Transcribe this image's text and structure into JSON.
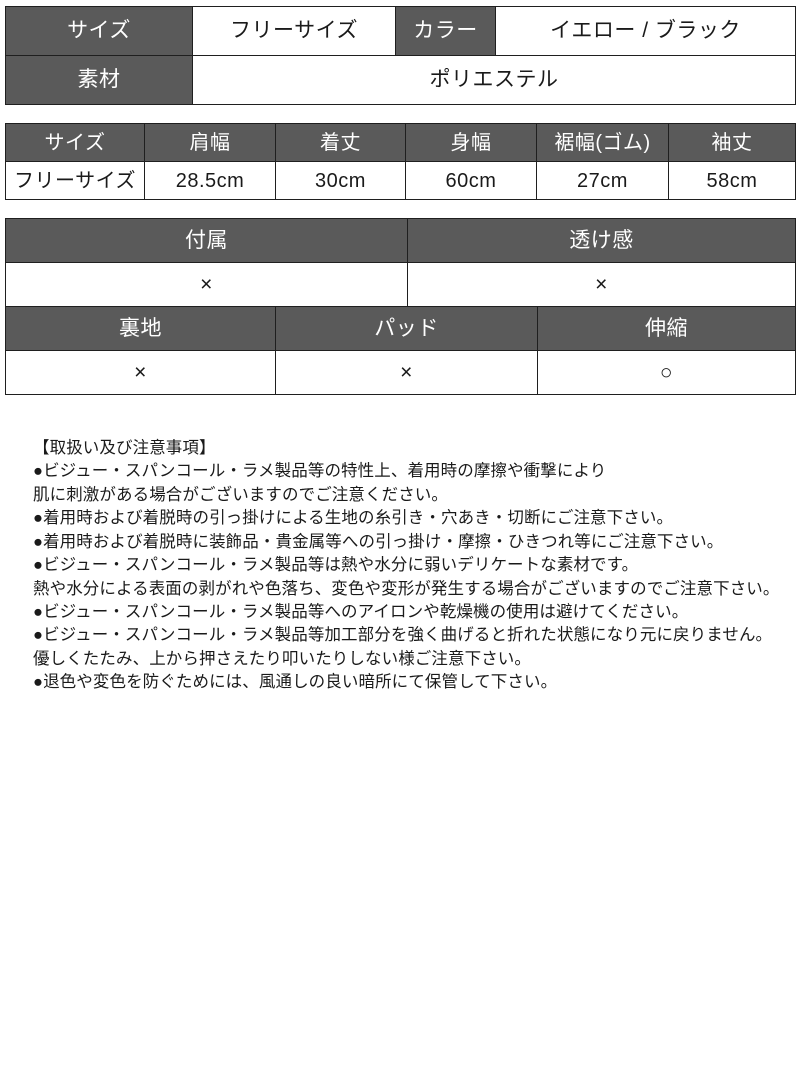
{
  "tables": {
    "basic": {
      "rows": [
        {
          "cells": [
            {
              "text": "サイズ",
              "type": "header",
              "name": "label-size"
            },
            {
              "text": "フリーサイズ",
              "type": "value",
              "name": "value-size"
            },
            {
              "text": "カラー",
              "type": "header",
              "name": "label-color"
            },
            {
              "text": "イエロー / ブラック",
              "type": "value",
              "name": "value-color"
            }
          ]
        },
        {
          "cells": [
            {
              "text": "素材",
              "type": "header",
              "name": "label-material"
            },
            {
              "text": "ポリエステル",
              "type": "value",
              "name": "value-material"
            }
          ]
        }
      ]
    },
    "measurements": {
      "headers": [
        "サイズ",
        "肩幅",
        "着丈",
        "身幅",
        "裾幅(ゴム)",
        "袖丈"
      ],
      "values": [
        "フリーサイズ",
        "28.5cm",
        "30cm",
        "60cm",
        "27cm",
        "58cm"
      ]
    },
    "features": {
      "group1": {
        "headers": [
          "付属",
          "透け感"
        ],
        "values": [
          "×",
          "×"
        ]
      },
      "group2": {
        "headers": [
          "裏地",
          "パッド",
          "伸縮"
        ],
        "values": [
          "×",
          "×",
          "○"
        ]
      }
    }
  },
  "notes": {
    "title": "【取扱い及び注意事項】",
    "lines": [
      "●ビジュー・スパンコール・ラメ製品等の特性上、着用時の摩擦や衝撃により",
      "肌に刺激がある場合がございますのでご注意ください。",
      "●着用時および着脱時の引っ掛けによる生地の糸引き・穴あき・切断にご注意下さい。",
      "●着用時および着脱時に装飾品・貴金属等への引っ掛け・摩擦・ひきつれ等にご注意下さい。",
      "●ビジュー・スパンコール・ラメ製品等は熱や水分に弱いデリケートな素材です。",
      "熱や水分による表面の剥がれや色落ち、変色や変形が発生する場合がございますのでご注意下さい。",
      "●ビジュー・スパンコール・ラメ製品等へのアイロンや乾燥機の使用は避けてください。",
      "●ビジュー・スパンコール・ラメ製品等加工部分を強く曲げると折れた状態になり元に戻りません。",
      "優しくたたみ、上から押さえたり叩いたりしない様ご注意下さい。",
      "●退色や変色を防ぐためには、風通しの良い暗所にて保管して下さい。"
    ]
  },
  "colors": {
    "header_bg": "#5a5a5a",
    "header_text": "#ffffff",
    "border": "#1f1f1f",
    "body_text": "#1a1a1a",
    "page_bg": "#ffffff"
  }
}
